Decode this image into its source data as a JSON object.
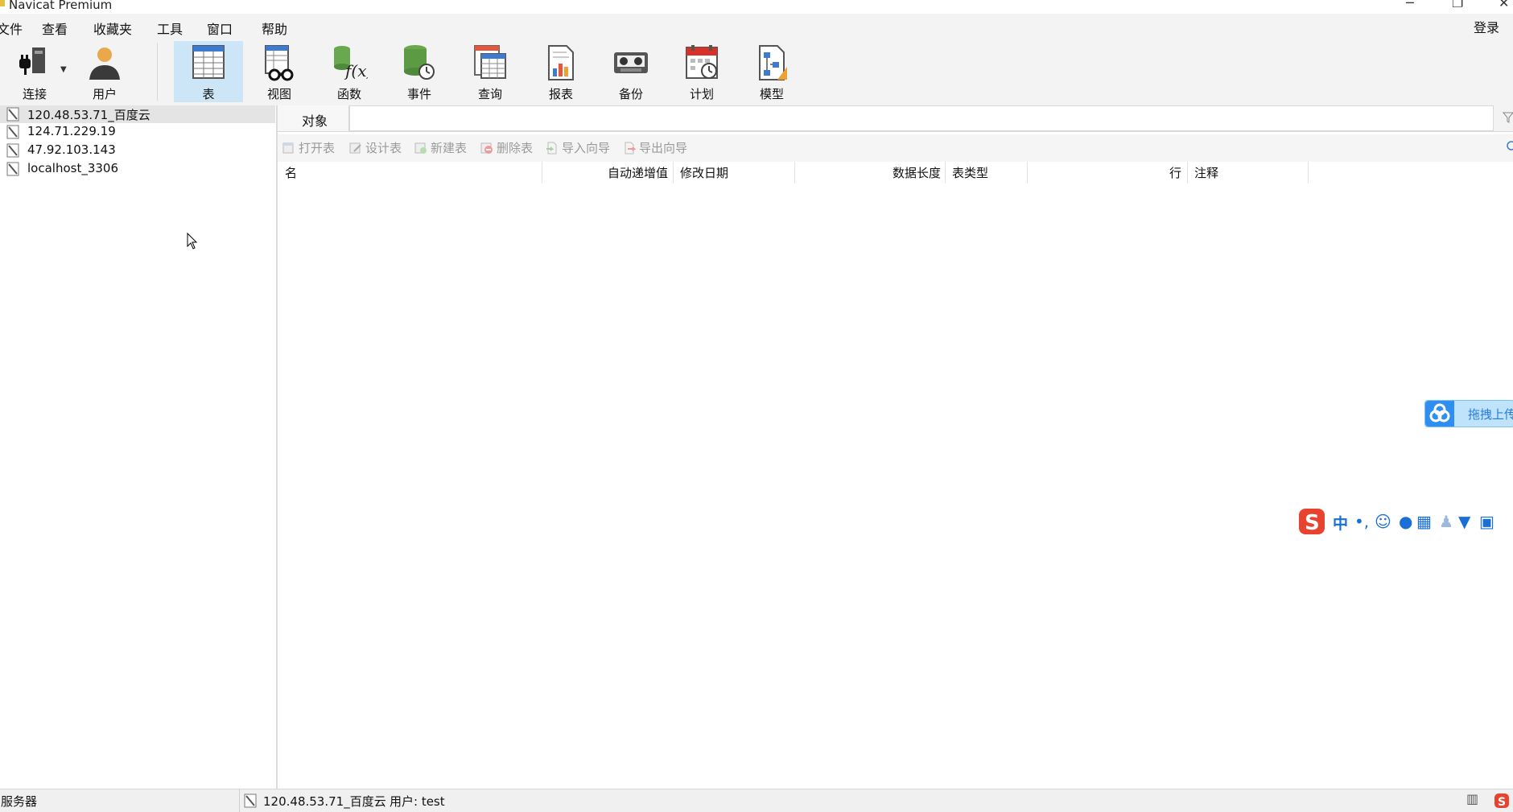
{
  "window": {
    "title": "Navicat Premium",
    "minimize": "─",
    "restore": "❐",
    "close": "✕"
  },
  "menu": {
    "items": [
      {
        "label": "文件"
      },
      {
        "label": "查看"
      },
      {
        "label": "收藏夹"
      },
      {
        "label": "工具"
      },
      {
        "label": "窗口"
      },
      {
        "label": "帮助"
      }
    ],
    "login": "登录"
  },
  "toolbar": {
    "buttons": [
      {
        "label": "连接",
        "icon": "plug-icon"
      },
      {
        "label": "用户",
        "icon": "user-icon"
      },
      {
        "label": "表",
        "icon": "table-icon",
        "selected": true
      },
      {
        "label": "视图",
        "icon": "view-icon"
      },
      {
        "label": "函数",
        "icon": "function-icon"
      },
      {
        "label": "事件",
        "icon": "event-icon"
      },
      {
        "label": "查询",
        "icon": "query-icon"
      },
      {
        "label": "报表",
        "icon": "report-icon"
      },
      {
        "label": "备份",
        "icon": "backup-icon"
      },
      {
        "label": "计划",
        "icon": "schedule-icon"
      },
      {
        "label": "模型",
        "icon": "model-icon"
      }
    ]
  },
  "connections": [
    {
      "label": "120.48.53.71_百度云",
      "selected": true
    },
    {
      "label": "124.71.229.19"
    },
    {
      "label": "47.92.103.143"
    },
    {
      "label": "localhost_3306"
    }
  ],
  "tabs": {
    "object": "对象"
  },
  "actions": [
    {
      "label": "打开表"
    },
    {
      "label": "设计表"
    },
    {
      "label": "新建表"
    },
    {
      "label": "删除表"
    },
    {
      "label": "导入向导"
    },
    {
      "label": "导出向导"
    }
  ],
  "table": {
    "columns": [
      "名",
      "自动递增值",
      "修改日期",
      "数据长度",
      "表类型",
      "行",
      "注释"
    ]
  },
  "status": {
    "left": "服务器",
    "connection": "120.48.53.71_百度云",
    "user": "用户: test"
  },
  "overlays": {
    "cloud_upload": "拖拽上传",
    "ime_mode": "中"
  },
  "colors": {
    "selection": "#cde6f7",
    "toolbar_bg": "#f3f3f3",
    "cloud_blue": "#2f8ff0",
    "sogou_red": "#e8432f"
  }
}
